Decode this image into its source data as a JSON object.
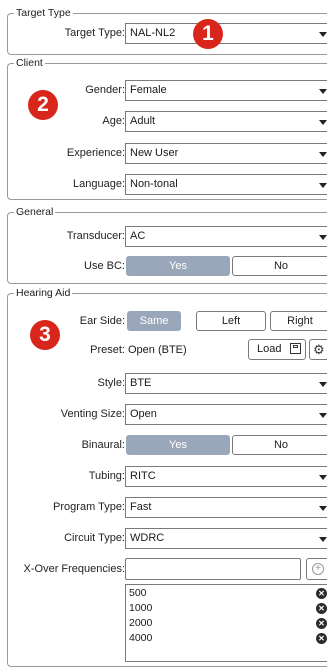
{
  "target_type": {
    "legend": "Target Type",
    "label": "Target Type:",
    "value": "NAL-NL2",
    "badge": "1"
  },
  "client": {
    "legend": "Client",
    "badge": "2",
    "gender_label": "Gender:",
    "gender_value": "Female",
    "age_label": "Age:",
    "age_value": "Adult",
    "experience_label": "Experience:",
    "experience_value": "New User",
    "language_label": "Language:",
    "language_value": "Non-tonal"
  },
  "general": {
    "legend": "General",
    "transducer_label": "Transducer:",
    "transducer_value": "AC",
    "use_bc_label": "Use BC:",
    "use_bc_yes": "Yes",
    "use_bc_no": "No"
  },
  "hearing_aid": {
    "legend": "Hearing Aid",
    "badge": "3",
    "ear_side_label": "Ear Side:",
    "ear_same": "Same",
    "ear_left": "Left",
    "ear_right": "Right",
    "preset_label": "Preset:",
    "preset_value": "Open (BTE)",
    "load_label": "Load",
    "style_label": "Style:",
    "style_value": "BTE",
    "venting_label": "Venting Size:",
    "venting_value": "Open",
    "binaural_label": "Binaural:",
    "binaural_yes": "Yes",
    "binaural_no": "No",
    "tubing_label": "Tubing:",
    "tubing_value": "RITC",
    "program_label": "Program Type:",
    "program_value": "Fast",
    "circuit_label": "Circuit Type:",
    "circuit_value": "WDRC",
    "xover_label": "X-Over Frequencies:",
    "xover_input": "",
    "frequencies": [
      "500",
      "1000",
      "2000",
      "4000"
    ]
  },
  "colors": {
    "badge": "#d9261c",
    "selected_segment": "#9aa7ba"
  }
}
